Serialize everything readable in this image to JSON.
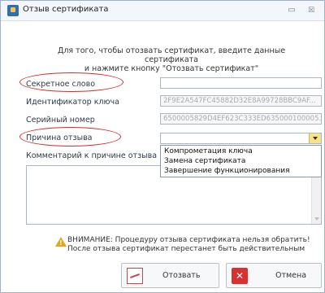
{
  "window": {
    "title": "Отзыв сертификата",
    "minimize_glyph": "▭",
    "close_glyph": "☒"
  },
  "intro": {
    "line1": "Для того, чтобы отозвать сертификат, введите данные сертификата",
    "line2": "и нажмите кнопку \"Отозвать сертификат\""
  },
  "form": {
    "secret_word": {
      "label": "Секретное слово",
      "value": ""
    },
    "key_id": {
      "label": "Идентификатор ключа",
      "value": "2F9E2A547FC45882D32E8A99728BBC9AF..."
    },
    "serial": {
      "label": "Серийный номер",
      "value": "6500005829D4EF623C333ED635000100005..."
    },
    "reason": {
      "label": "Причина отзыва",
      "value": ""
    },
    "reason_options": [
      "Компрометация ключа",
      "Замена сертификата",
      "Завершение функционирования"
    ],
    "comment": {
      "label": "Комментарий к причине отзыва",
      "value": ""
    }
  },
  "warning": {
    "line1": "ВНИМАНИЕ: Процедуру отзыва сертификата нельзя обратить!",
    "line2": "После отзыва сертификат перестанет быть действительным"
  },
  "buttons": {
    "revoke": "Отозвать",
    "cancel": "Отмена"
  },
  "colors": {
    "annotation": "#d62a2a",
    "dropdown_arrow": "#f5e28b",
    "cancel_icon": "#d93030"
  }
}
